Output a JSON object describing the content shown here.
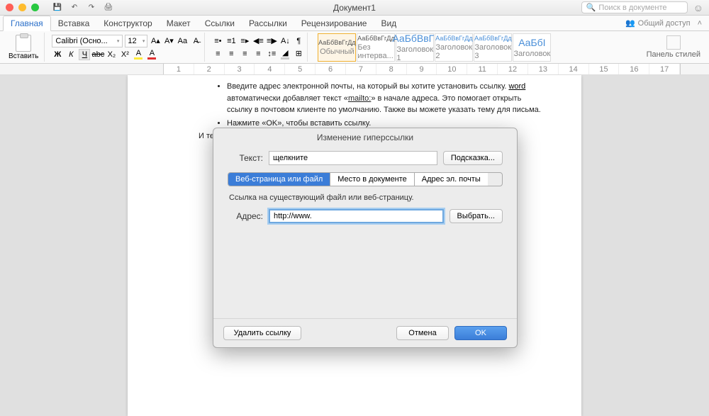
{
  "title": "Документ1",
  "search_placeholder": "Поиск в документе",
  "tabs": [
    "Главная",
    "Вставка",
    "Конструктор",
    "Макет",
    "Ссылки",
    "Рассылки",
    "Рецензирование",
    "Вид"
  ],
  "share": "Общий доступ",
  "paste_label": "Вставить",
  "font_name": "Calibri (Осно...",
  "font_size": "12",
  "ruler": [
    "1",
    "2",
    "3",
    "4",
    "5",
    "6",
    "7",
    "8",
    "9",
    "10",
    "11",
    "12",
    "13",
    "14",
    "15",
    "16",
    "17"
  ],
  "styles": [
    {
      "preview": "АаБбВвГгДд",
      "name": "Обычный"
    },
    {
      "preview": "АаБбВвГгДд",
      "name": "Без интерва..."
    },
    {
      "preview": "АаБбВвГг",
      "name": "Заголовок 1"
    },
    {
      "preview": "АаБбВвГгДд",
      "name": "Заголовок 2"
    },
    {
      "preview": "АаБбВвГгДд",
      "name": "Заголовок 3"
    },
    {
      "preview": "АаБбІ",
      "name": "Заголовок"
    }
  ],
  "panel_label": "Панель стилей",
  "doc": {
    "li1a": "Введите адрес электронной почты, на который вы хотите установить ссылку. ",
    "li1b": "word",
    "li1c": " автоматически добавляет текст «",
    "li1d": "mailto:",
    "li1e": "» в начале адреса. Это помогает открыть ссылку в почтовом клиенте по умолчанию. Также вы можете указать тему для письма.",
    "li2": "Нажмите «OK», чтобы вставить ссылку.",
    "p1": "И теперь всякий раз когда вы нажимаете на ссылку должно создаваться новое"
  },
  "dialog": {
    "title": "Изменение гиперссылки",
    "text_label": "Текст:",
    "text_value": "щелкните",
    "tip_btn": "Подсказка...",
    "tab1": "Веб-страница или файл",
    "tab2": "Место в документе",
    "tab3": "Адрес эл. почты",
    "hint": "Ссылка на существующий файл или веб-страницу.",
    "addr_label": "Адрес:",
    "addr_value": "http://www.",
    "browse": "Выбрать...",
    "remove": "Удалить ссылку",
    "cancel": "Отмена",
    "ok": "OK"
  }
}
